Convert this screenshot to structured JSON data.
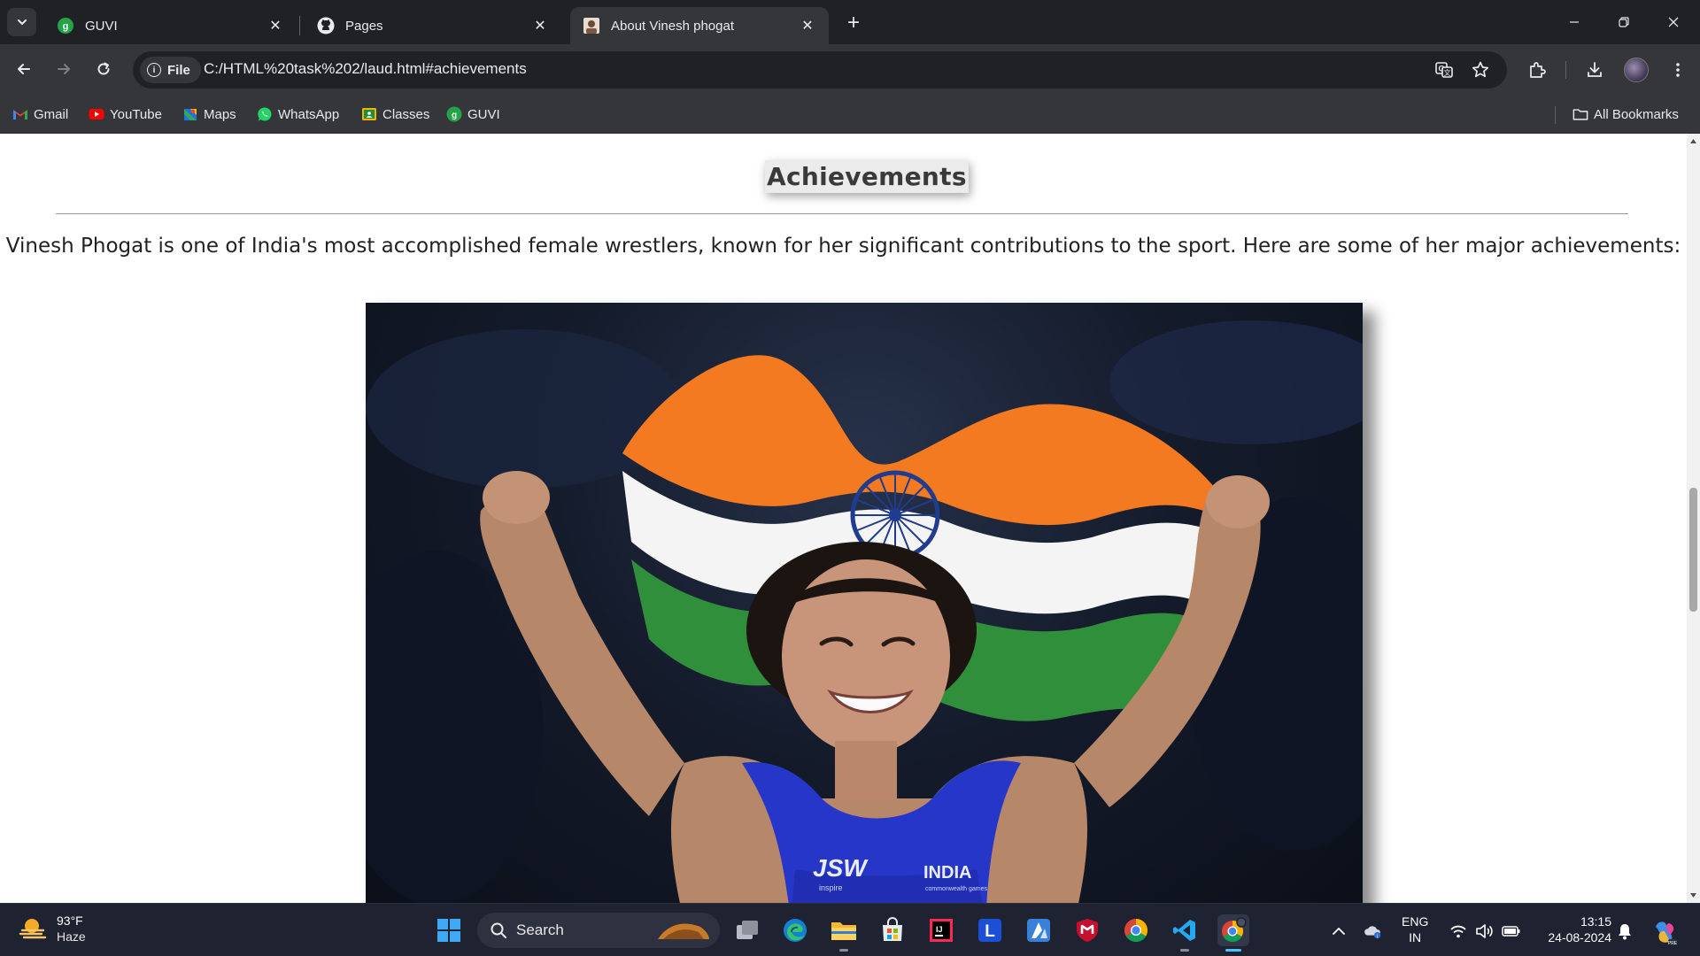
{
  "browser": {
    "tabs": [
      {
        "title": "GUVI",
        "favicon": "guvi-icon",
        "active": false
      },
      {
        "title": "Pages",
        "favicon": "github-icon",
        "active": false
      },
      {
        "title": "About Vinesh phogat",
        "favicon": "portrait-icon",
        "active": true
      }
    ],
    "address": {
      "chip_label": "File",
      "url": "C:/HTML%20task%202/laud.html#achievements"
    },
    "bookmarks": [
      {
        "label": "Gmail",
        "icon": "gmail-icon"
      },
      {
        "label": "YouTube",
        "icon": "youtube-icon"
      },
      {
        "label": "Maps",
        "icon": "maps-icon"
      },
      {
        "label": "WhatsApp",
        "icon": "whatsapp-icon"
      },
      {
        "label": "Classes",
        "icon": "classroom-icon"
      },
      {
        "label": "GUVI",
        "icon": "guvi-icon"
      }
    ],
    "all_bookmarks_label": "All Bookmarks"
  },
  "page": {
    "heading": "Achievements",
    "intro": "Vinesh Phogat is one of India's most accomplished female wrestlers, known for her significant contributions to the sport. Here are some of her major achievements:",
    "photo_text": {
      "sponsor": "JSW",
      "sponsor_sub": "inspire",
      "team": "INDIA",
      "team_sub": "commonwealth games"
    }
  },
  "taskbar": {
    "weather": {
      "temp": "93°F",
      "condition": "Haze"
    },
    "search_label": "Search",
    "language": {
      "line1": "ENG",
      "line2": "IN"
    },
    "clock": {
      "time": "13:15",
      "date": "24-08-2024"
    }
  },
  "colors": {
    "saffron": "#f47a22",
    "green": "#2f8f3a",
    "chakra": "#1f3c8f",
    "jersey": "#2636c8"
  }
}
